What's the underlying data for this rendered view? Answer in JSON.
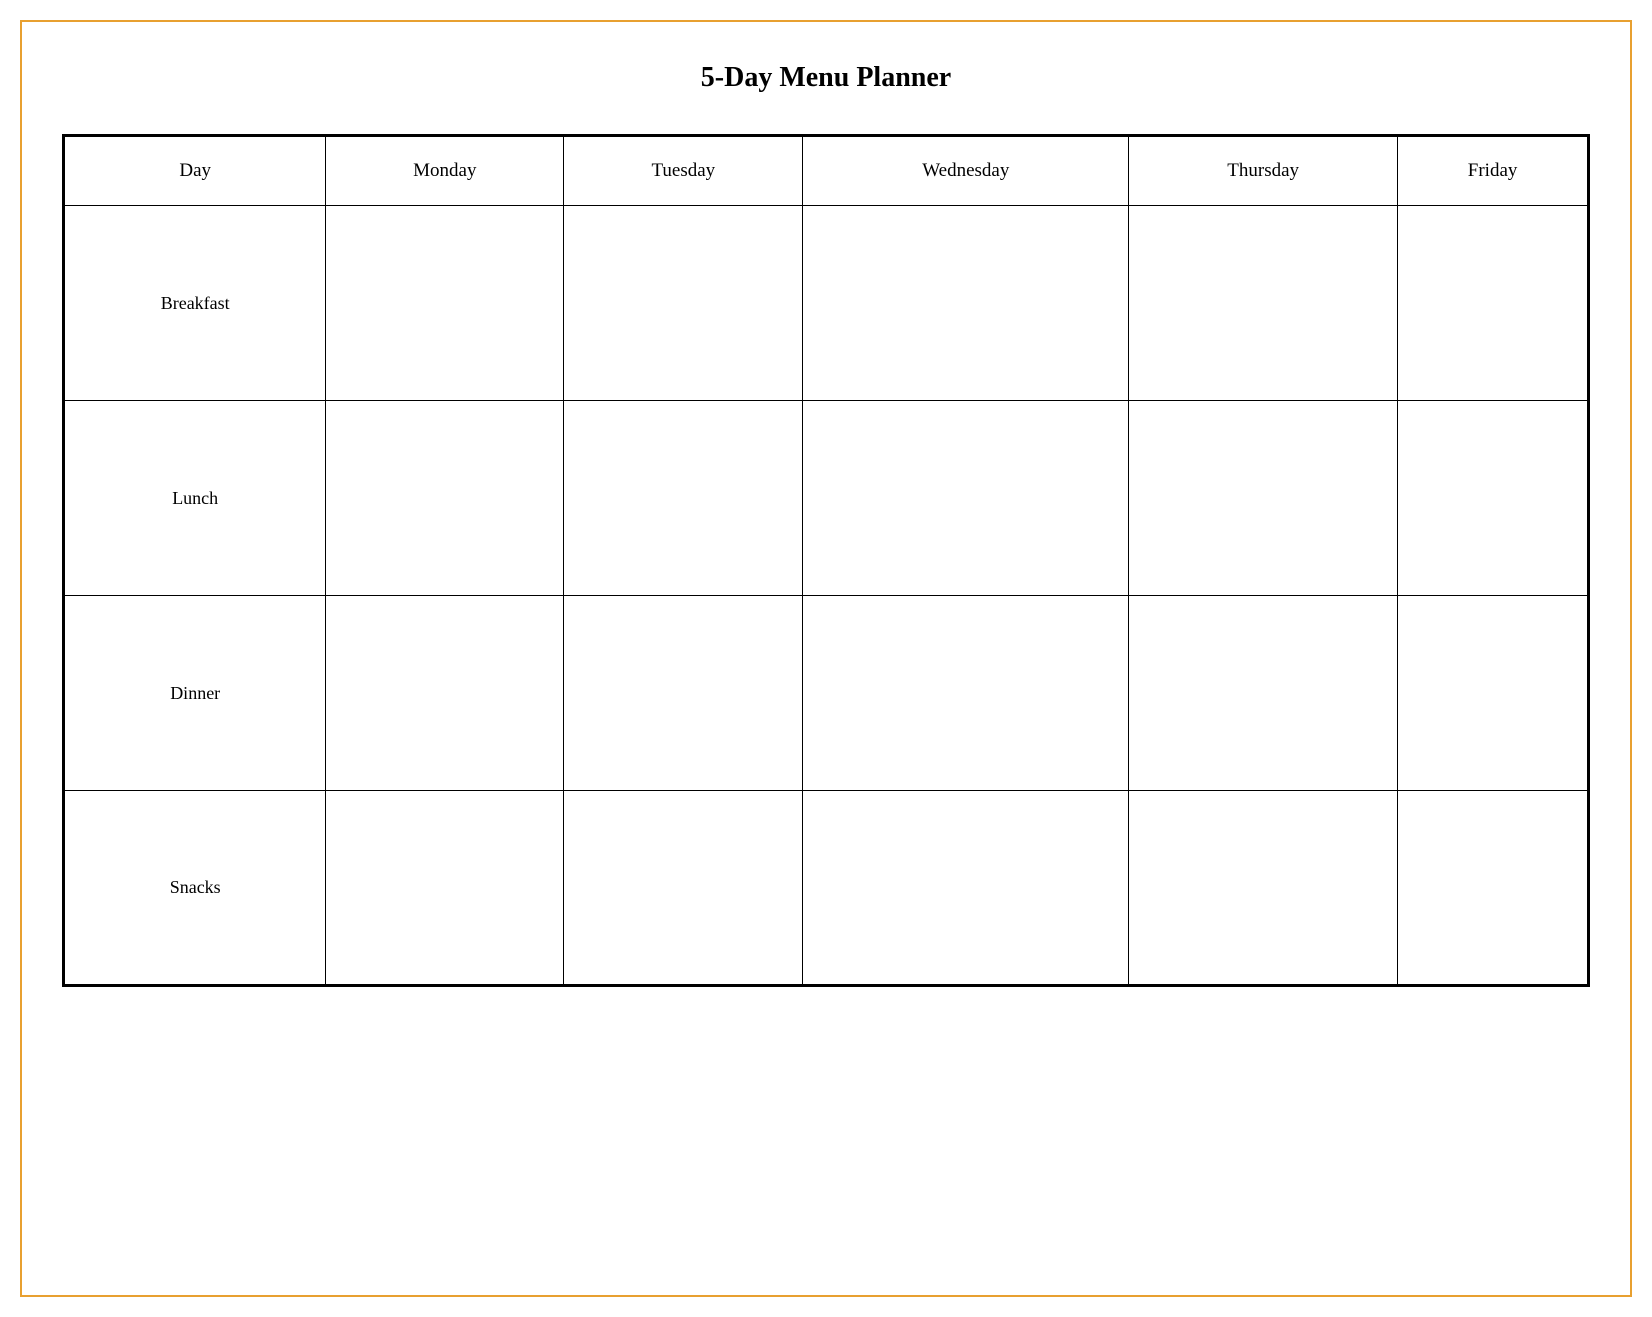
{
  "title": "5-Day Menu Planner",
  "columns": {
    "day": "Day",
    "monday": "Monday",
    "tuesday": "Tuesday",
    "wednesday": "Wednesday",
    "thursday": "Thursday",
    "friday": "Friday"
  },
  "rows": [
    {
      "meal": "Breakfast"
    },
    {
      "meal": "Lunch"
    },
    {
      "meal": "Dinner"
    },
    {
      "meal": "Snacks"
    }
  ]
}
